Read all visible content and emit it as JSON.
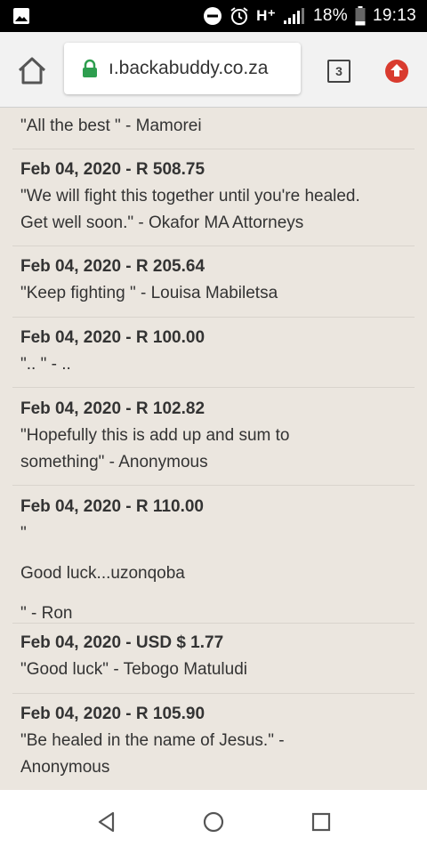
{
  "status_bar": {
    "network": "H⁺",
    "battery_percent": "18%",
    "time": "19:13",
    "icons": [
      "image-icon",
      "do-not-disturb-icon",
      "alarm-icon",
      "signal-icon",
      "battery-icon"
    ]
  },
  "browser": {
    "url": "ı.backabuddy.co.za",
    "tab_count": "3",
    "icons": [
      "home-icon",
      "lock-icon",
      "tabs-icon",
      "upload-icon"
    ],
    "accent_colors": {
      "lock": "#2e9e4f",
      "upload": "#d93b2f"
    }
  },
  "donations": {
    "top_partial": {
      "message": "\"All the best \" - Mamorei"
    },
    "entries": [
      {
        "date": "Feb 04, 2020",
        "amount": "R 508.75",
        "message_lines": [
          "\"We will fight this together until you're healed.",
          "Get well soon.\" - Okafor MA Attorneys"
        ]
      },
      {
        "date": "Feb 04, 2020",
        "amount": "R 205.64",
        "message_lines": [
          "\"Keep fighting \" - Louisa Mabiletsa"
        ]
      },
      {
        "date": "Feb 04, 2020",
        "amount": "R 100.00",
        "message_lines": [
          "\".. \" - .."
        ]
      },
      {
        "date": "Feb 04, 2020",
        "amount": "R 102.82",
        "message_lines": [
          "\"Hopefully this is add up and sum to",
          "something\" - Anonymous"
        ]
      },
      {
        "date": "Feb 04, 2020",
        "amount": "R 110.00",
        "message_lines": [
          "\"",
          "Good luck...uzonqoba",
          "\" - Ron"
        ]
      },
      {
        "date": "Feb 04, 2020",
        "amount": "USD $ 1.77",
        "message_lines": [
          "\"Good luck\" - Tebogo Matuludi"
        ]
      },
      {
        "date": "Feb 04, 2020",
        "amount": "R 105.90",
        "message_lines": [
          "\"Be healed in the name of Jesus.\" -",
          "Anonymous"
        ]
      }
    ]
  },
  "nav_bar": {
    "icons": [
      "back-icon",
      "home-circle-icon",
      "recents-icon"
    ]
  }
}
